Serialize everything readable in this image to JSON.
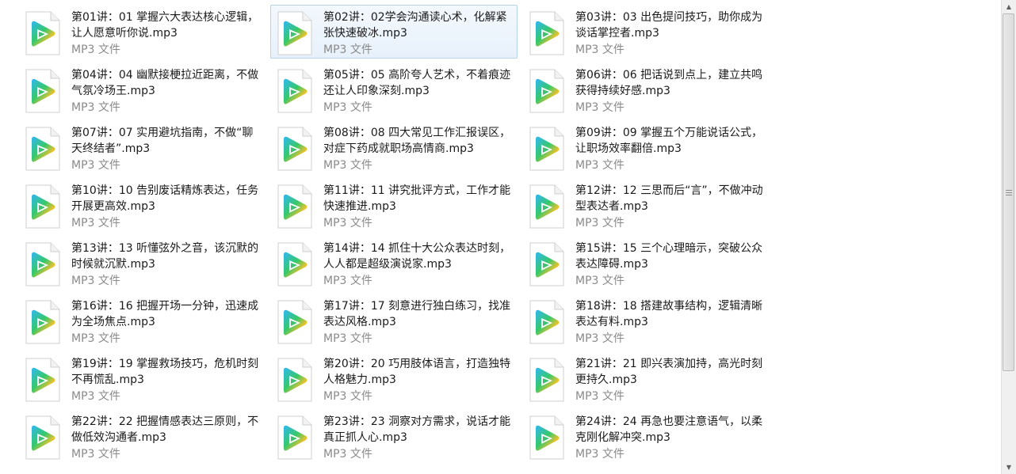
{
  "files": [
    {
      "name": "第01讲：01 掌握六大表达核心逻辑，让人愿意听你说.mp3",
      "type": "MP3 文件",
      "selected": false
    },
    {
      "name": "第02讲：02学会沟通读心术，化解紧张快速破冰.mp3",
      "type": "MP3 文件",
      "selected": true
    },
    {
      "name": "第03讲：03 出色提问技巧，助你成为谈话掌控者.mp3",
      "type": "MP3 文件",
      "selected": false
    },
    {
      "name": "第04讲：04 幽默接梗拉近距离，不做气氛冷场王.mp3",
      "type": "MP3 文件",
      "selected": false
    },
    {
      "name": "第05讲：05 高阶夸人艺术，不着痕迹还让人印象深刻.mp3",
      "type": "MP3 文件",
      "selected": false
    },
    {
      "name": "第06讲：06 把话说到点上，建立共鸣获得持续好感.mp3",
      "type": "MP3 文件",
      "selected": false
    },
    {
      "name": "第07讲：07 实用避坑指南，不做“聊天终结者”.mp3",
      "type": "MP3 文件",
      "selected": false
    },
    {
      "name": "第08讲：08 四大常见工作汇报误区，对症下药成就职场高情商.mp3",
      "type": "MP3 文件",
      "selected": false
    },
    {
      "name": "第09讲：09 掌握五个万能说话公式，让职场效率翻倍.mp3",
      "type": "MP3 文件",
      "selected": false
    },
    {
      "name": "第10讲：10 告别废话精炼表达，任务开展更高效.mp3",
      "type": "MP3 文件",
      "selected": false
    },
    {
      "name": "第11讲：11 讲究批评方式，工作才能快速推进.mp3",
      "type": "MP3 文件",
      "selected": false
    },
    {
      "name": "第12讲：12 三思而后“言”，不做冲动型表达者.mp3",
      "type": "MP3 文件",
      "selected": false
    },
    {
      "name": "第13讲：13 听懂弦外之音，该沉默的时候就沉默.mp3",
      "type": "MP3 文件",
      "selected": false
    },
    {
      "name": "第14讲：14 抓住十大公众表达时刻，人人都是超级演说家.mp3",
      "type": "MP3 文件",
      "selected": false
    },
    {
      "name": "第15讲：15 三个心理暗示，突破公众表达障碍.mp3",
      "type": "MP3 文件",
      "selected": false
    },
    {
      "name": "第16讲：16 把握开场一分钟，迅速成为全场焦点.mp3",
      "type": "MP3 文件",
      "selected": false
    },
    {
      "name": "第17讲：17 刻意进行独白练习，找准表达风格.mp3",
      "type": "MP3 文件",
      "selected": false
    },
    {
      "name": "第18讲：18 搭建故事结构，逻辑清晰表达有料.mp3",
      "type": "MP3 文件",
      "selected": false
    },
    {
      "name": "第19讲：19 掌握救场技巧，危机时刻不再慌乱.mp3",
      "type": "MP3 文件",
      "selected": false
    },
    {
      "name": "第20讲：20 巧用肢体语言，打造独特人格魅力.mp3",
      "type": "MP3 文件",
      "selected": false
    },
    {
      "name": "第21讲：21 即兴表演加持，高光时刻更持久.mp3",
      "type": "MP3 文件",
      "selected": false
    },
    {
      "name": "第22讲：22 把握情感表达三原则，不做低效沟通者.mp3",
      "type": "MP3 文件",
      "selected": false
    },
    {
      "name": "第23讲：23 洞察对方需求，说话才能真正抓人心.mp3",
      "type": "MP3 文件",
      "selected": false
    },
    {
      "name": "第24讲：24 再急也要注意语气，以柔克刚化解冲突.mp3",
      "type": "MP3 文件",
      "selected": false
    }
  ],
  "icon": "player-media-file-icon",
  "colors": {
    "selection_bg": "#e8f1fb",
    "selection_border": "#b8d2ea",
    "name_text": "#1a1a1a",
    "type_text": "#8a8a8a"
  },
  "scrollbar": {
    "up_arrow": "▲",
    "down_arrow": "▼"
  }
}
